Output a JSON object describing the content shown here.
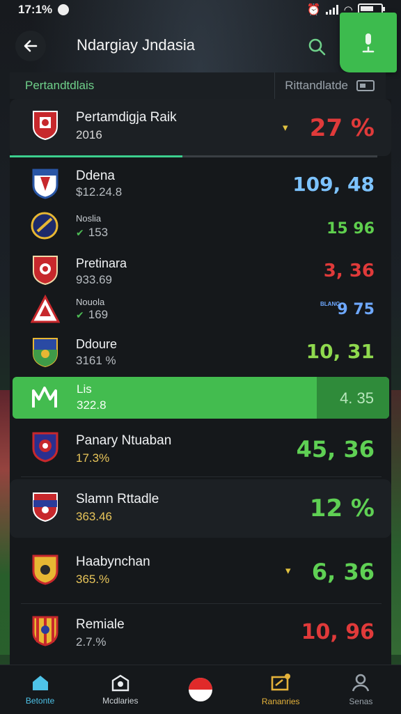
{
  "status": {
    "time": "17:1%"
  },
  "header": {
    "title": "Ndargiay Jndasia"
  },
  "subheader": {
    "left": "Pertandtdlais",
    "right": "Rittandlatde"
  },
  "top_row": {
    "name": "Pertamdigja Raik",
    "sub": "2016",
    "value": "27 %",
    "value_color": "#e03a3a",
    "progress": 0.47
  },
  "rows": [
    {
      "name": "Ddena",
      "sub": "$12.24.8",
      "value": "109, 48",
      "value_color": "#7dc3ff"
    },
    {
      "name": "Noslia",
      "sub": "153",
      "value": "15 96",
      "value_color": "#5fcf4e",
      "check": true
    },
    {
      "name": "Pretinara",
      "sub": "933.69",
      "value": "3, 36",
      "value_color": "#e03a3a"
    },
    {
      "name": "Nouola",
      "sub": "169",
      "value": "9 75",
      "value_color": "#6ea8ff",
      "check": true,
      "tag": "BLANG"
    },
    {
      "name": "Ddoure",
      "sub": "3161 %",
      "value": "10, 31",
      "value_color": "#8fd94e"
    }
  ],
  "highlight": {
    "name": "Lis",
    "sub": "322.8",
    "value": "4. 35"
  },
  "big_rows": [
    {
      "name": "Panary Ntuaban",
      "sub": "17.3%",
      "value": "45, 36",
      "value_color": "#5fd054"
    },
    {
      "name": "Slamn Rttadle",
      "sub": "363.46",
      "value": "12 %",
      "value_color": "#5fd054"
    },
    {
      "name": "Haabynchan",
      "sub": "365.%",
      "value": "6, 36",
      "value_color": "#5fd054"
    },
    {
      "name": "Remiale",
      "sub": "2.7.%",
      "value": "10, 96",
      "value_color": "#e03a3a"
    }
  ],
  "nav": [
    {
      "label": "Betonte",
      "icon": "home-icon"
    },
    {
      "label": "Mcdlaries",
      "icon": "stadium-icon"
    },
    {
      "label": "",
      "icon": "ball-icon"
    },
    {
      "label": "Rananries",
      "icon": "ticket-icon"
    },
    {
      "label": "Senas",
      "icon": "profile-icon"
    }
  ]
}
